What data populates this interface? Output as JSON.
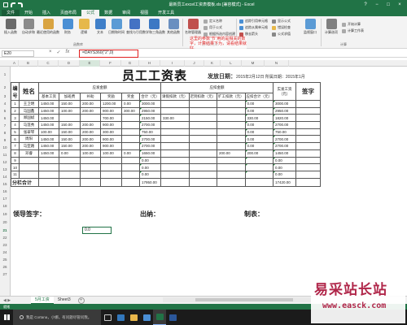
{
  "window": {
    "title": "最新员工excel工资表模板.xls [兼容模式] - Excel",
    "controls": [
      "?",
      "−",
      "□",
      "×"
    ]
  },
  "menu": {
    "tabs": [
      "文件",
      "开始",
      "插入",
      "页面布局",
      "公式",
      "数据",
      "审阅",
      "视图",
      "开发工具"
    ],
    "active_index": 4
  },
  "ribbon": {
    "buttons": [
      "插入函数",
      "自动求和",
      "最近使用的函数",
      "财务",
      "逻辑",
      "文本",
      "日期和时间",
      "查找与引用",
      "数学和三角函数",
      "其他函数",
      "名称管理器"
    ],
    "group_function_library": "函数库",
    "group_defined_names": "定义的名称",
    "defined_names_items": [
      "定义名称",
      "用于公式",
      "根据所选内容创建"
    ],
    "audit_items": [
      "追踪引用单元格",
      "追踪从属单元格",
      "移去箭头",
      "显示公式",
      "错误检查",
      "公式求值"
    ],
    "watch_label": "监视窗口",
    "calc_label": "计算选项",
    "calc_items": [
      "开始计算",
      "计算工作表"
    ],
    "group_calc": "计算",
    "annotation": "这里的参数“节”用的是相关的数字，计算结果下为，请看结果就好。"
  },
  "formula_bar": {
    "name_box": "E20",
    "formula": "=DAYS360(\"2\",0)",
    "cancel_icon": "×",
    "enter_icon": "✓",
    "fx": "fx"
  },
  "columns": [
    "A",
    "B",
    "C",
    "D",
    "E",
    "F",
    "G",
    "H",
    "I",
    "J",
    "K",
    "L",
    "M",
    "N"
  ],
  "rows": [
    "1",
    "2",
    "3",
    "4",
    "5",
    "6",
    "7",
    "8",
    "9",
    "10",
    "11",
    "12",
    "13",
    "14",
    "15",
    "16",
    "17",
    "18",
    "19",
    "20",
    "21",
    "22",
    "23",
    "24",
    "25",
    "26",
    "27"
  ],
  "sheet": {
    "title": "员工工资表",
    "issue_label": "发放日期：",
    "issue_value": "2015年2月12日 所属日期：2015年1月",
    "headers": {
      "no": "编号",
      "name": "姓名",
      "payable": "应发金额",
      "deduct": "应扣金额",
      "actual": "实发工资（元）",
      "sign": "签字",
      "sub_payable": [
        "基本工资",
        "加班费",
        "补助",
        "奖励",
        "奖金",
        "合计（元）"
      ],
      "sub_deduct": [
        "请假扣款（元）",
        "迟到扣款（元）",
        "旷工扣款（元）",
        "应扣合计（元）"
      ]
    },
    "rows": [
      {
        "no": "1",
        "name": "王卫明",
        "base": "1450.00",
        "ot": "150.00",
        "sub": "200.00",
        "bonus": "1200.00",
        "prize": "0.00",
        "total": "3000.00",
        "leave": "",
        "late": "",
        "absent": "",
        "ded_total": "0.00",
        "actual": "3000.00"
      },
      {
        "no": "2",
        "name": "马国鑫",
        "base": "1450.00",
        "ot": "100.00",
        "sub": "200.00",
        "bonus": "900.00",
        "prize": "300.00",
        "total": "2950.00",
        "leave": "",
        "late": "",
        "absent": "",
        "ded_total": "0.00",
        "actual": "2950.00"
      },
      {
        "no": "3",
        "name": "郑国斌",
        "base": "1450.00",
        "ot": "",
        "sub": "",
        "bonus": "700.00",
        "prize": "",
        "total": "2150.00",
        "leave": "330.00",
        "late": "",
        "absent": "",
        "ded_total": "330.00",
        "actual": "1820.00"
      },
      {
        "no": "4",
        "name": "马莲秀",
        "base": "1450.00",
        "ot": "150.00",
        "sub": "200.00",
        "bonus": "900.00",
        "prize": "",
        "total": "2700.00",
        "leave": "",
        "late": "",
        "absent": "",
        "ded_total": "0.00",
        "actual": "2700.00"
      },
      {
        "no": "5",
        "name": "张翠琴",
        "base": "100.00",
        "ot": "150.00",
        "sub": "200.00",
        "bonus": "300.00",
        "prize": "",
        "total": "750.00",
        "leave": "",
        "late": "",
        "absent": "",
        "ded_total": "0.00",
        "actual": "750.00"
      },
      {
        "no": "6",
        "name": "周阳",
        "base": "1450.00",
        "ot": "150.00",
        "sub": "200.00",
        "bonus": "900.00",
        "prize": "",
        "total": "2700.00",
        "leave": "",
        "late": "",
        "absent": "",
        "ded_total": "0.00",
        "actual": "2700.00"
      },
      {
        "no": "7",
        "name": "马亚路",
        "base": "1450.00",
        "ot": "150.00",
        "sub": "200.00",
        "bonus": "900.00",
        "prize": "",
        "total": "2700.00",
        "leave": "",
        "late": "",
        "absent": "",
        "ded_total": "0.00",
        "actual": "2700.00"
      },
      {
        "no": "8",
        "name": "邓睿",
        "base": "1450.00",
        "ot": "0.00",
        "sub": "100.00",
        "bonus": "100.00",
        "prize": "0.00",
        "total": "1650.00",
        "leave": "",
        "late": "",
        "absent": "200.00",
        "ded_total": "200.00",
        "actual": "1450.00"
      },
      {
        "no": "9",
        "name": "",
        "base": "",
        "ot": "",
        "sub": "",
        "bonus": "",
        "prize": "",
        "total": "0.00",
        "leave": "",
        "late": "",
        "absent": "",
        "ded_total": "",
        "actual": "0.00"
      },
      {
        "no": "10",
        "name": "",
        "base": "",
        "ot": "",
        "sub": "",
        "bonus": "",
        "prize": "",
        "total": "0.00",
        "leave": "",
        "late": "",
        "absent": "",
        "ded_total": "",
        "actual": "0.00"
      },
      {
        "no": "11",
        "name": "",
        "base": "",
        "ot": "",
        "sub": "",
        "bonus": "",
        "prize": "",
        "total": "0.00",
        "leave": "",
        "late": "",
        "absent": "",
        "ded_total": "",
        "actual": "0.00"
      }
    ],
    "subtotal_label": "分栏合计",
    "subtotal_total": "17950.00",
    "subtotal_actual": "17420.00",
    "leader_sign": "领导签字：",
    "cashier": "出纳：",
    "preparer": "制表：",
    "selected_cell_value": "0.0"
  },
  "sheet_tabs": [
    "5月工资",
    "Sheet3"
  ],
  "active_sheet": 0,
  "status": "就绪",
  "taskbar": {
    "search_placeholder": "我是 Cortana，小娜。有问题尽管问我。"
  },
  "watermark": {
    "cn": "易采站长站",
    "url": "www.easck.com"
  },
  "colors": {
    "excel_green": "#217346",
    "annotation_red": "#e02020",
    "watermark": "#b0274a"
  }
}
